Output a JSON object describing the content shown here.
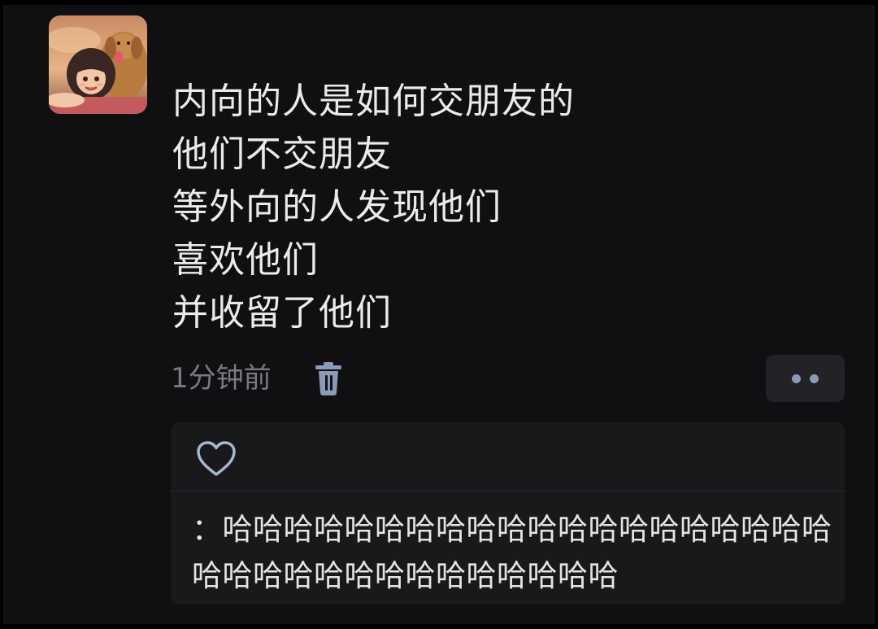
{
  "post": {
    "lines": [
      "内向的人是如何交朋友的",
      "他们不交朋友",
      "等外向的人发现他们",
      "喜欢他们",
      "并收留了他们"
    ],
    "timestamp": "1分钟前",
    "icons": {
      "avatar": "avatar-girl-with-dog",
      "delete": "trash-icon",
      "more": "more-dots-icon",
      "like": "heart-icon"
    }
  },
  "comment": {
    "text": "：哈哈哈哈哈哈哈哈哈哈哈哈哈哈哈哈哈哈哈哈哈哈哈哈哈哈哈哈哈哈哈哈哈哈"
  },
  "colors": {
    "background": "#101012",
    "text": "#ebebeb",
    "muted": "#7a7a7e",
    "accent": "#8a9ab8",
    "card": "#19191c"
  }
}
